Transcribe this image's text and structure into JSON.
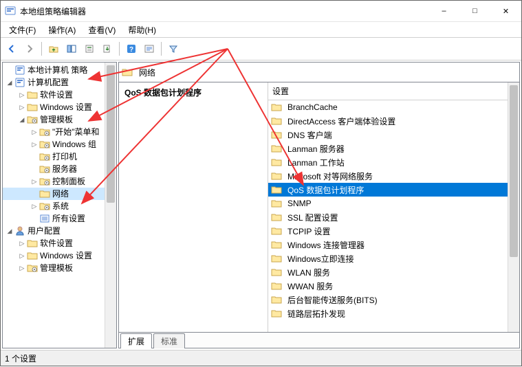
{
  "window_title": "本地组策略编辑器",
  "menu": {
    "file": "文件(F)",
    "action": "操作(A)",
    "view": "查看(V)",
    "help": "帮助(H)"
  },
  "tree": {
    "root": "本地计算机 策略",
    "computer_cfg": "计算机配置",
    "soft_settings": "软件设置",
    "win_settings": "Windows 设置",
    "admin_tpl": "管理模板",
    "start_menu": "\"开始\"菜单和",
    "win_components": "Windows 组",
    "printers": "打印机",
    "servers": "服务器",
    "control_panel": "控制面板",
    "network": "网络",
    "system": "系统",
    "all_settings": "所有设置",
    "user_cfg": "用户配置",
    "u_soft": "软件设置",
    "u_win": "Windows 设置",
    "u_admin": "管理模板"
  },
  "pathbar_label": "网络",
  "detail_title": "QoS 数据包计划程序",
  "list_header": "设置",
  "list": [
    "BranchCache",
    "DirectAccess 客户端体验设置",
    "DNS 客户端",
    "Lanman 服务器",
    "Lanman 工作站",
    "Microsoft 对等网络服务",
    "QoS 数据包计划程序",
    "SNMP",
    "SSL 配置设置",
    "TCPIP 设置",
    "Windows 连接管理器",
    "Windows立即连接",
    "WLAN 服务",
    "WWAN 服务",
    "后台智能传送服务(BITS)",
    "链路层拓扑发现"
  ],
  "selected_list_index": 6,
  "tabs": {
    "extended": "扩展",
    "standard": "标准"
  },
  "status": "1 个设置"
}
